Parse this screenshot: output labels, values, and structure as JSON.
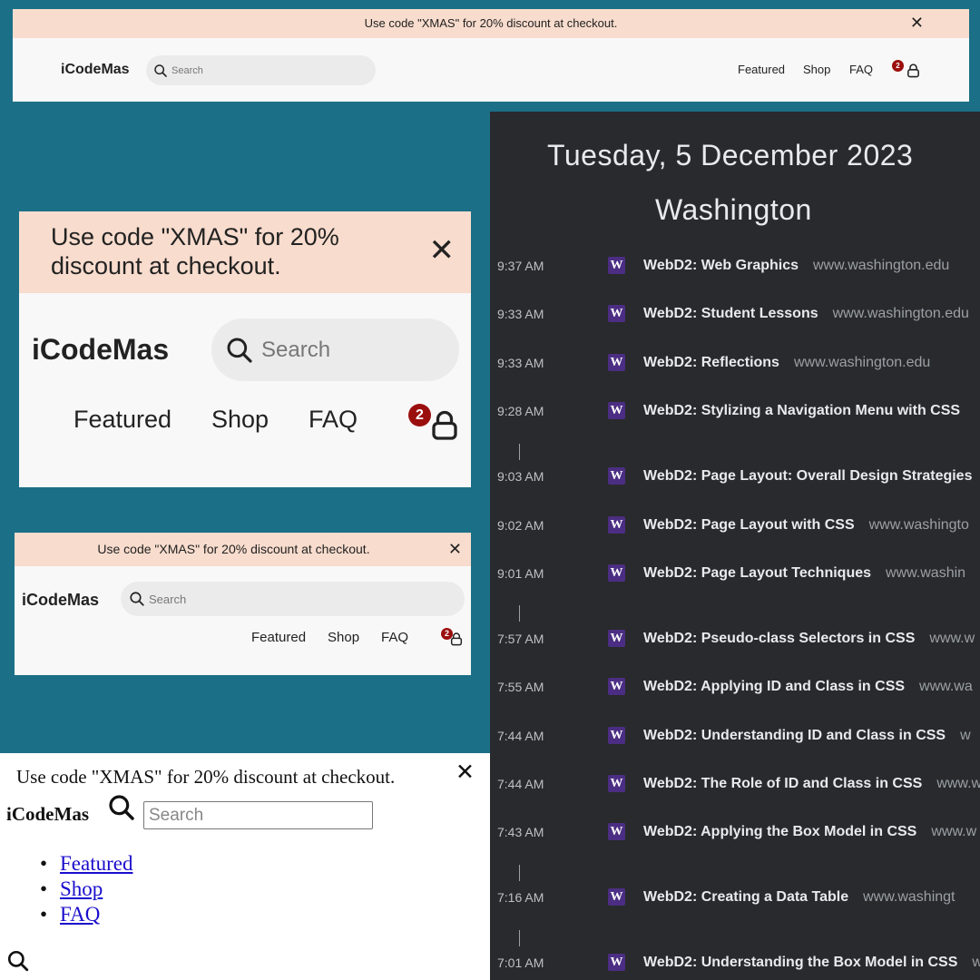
{
  "promo": {
    "text": "Use code \"XMAS\" for 20% discount at checkout.",
    "close_label": "✕"
  },
  "nav": {
    "brand": "iCodeMas",
    "search_placeholder": "Search",
    "links": [
      "Featured",
      "Shop",
      "FAQ"
    ],
    "cart_count": "2"
  },
  "history": {
    "date": "Tuesday, 5 December 2023",
    "location": "Washington",
    "favicon_letter": "W",
    "entries": [
      {
        "time": "9:37 AM",
        "title": "WebD2: Web Graphics",
        "domain": "www.washington.edu"
      },
      {
        "time": "9:33 AM",
        "title": "WebD2: Student Lessons",
        "domain": "www.washington.edu"
      },
      {
        "time": "9:33 AM",
        "title": "WebD2: Reflections",
        "domain": "www.washington.edu"
      },
      {
        "time": "9:28 AM",
        "title": "WebD2: Stylizing a Navigation Menu with CSS",
        "domain": ""
      },
      {
        "time": "9:03 AM",
        "title": "WebD2: Page Layout: Overall Design Strategies",
        "domain": ""
      },
      {
        "time": "9:02 AM",
        "title": "WebD2: Page Layout with CSS",
        "domain": "www.washingto"
      },
      {
        "time": "9:01 AM",
        "title": "WebD2: Page Layout Techniques",
        "domain": "www.washin"
      },
      {
        "time": "7:57 AM",
        "title": "WebD2: Pseudo-class Selectors in CSS",
        "domain": "www.w"
      },
      {
        "time": "7:55 AM",
        "title": "WebD2: Applying ID and Class in CSS",
        "domain": "www.wa"
      },
      {
        "time": "7:44 AM",
        "title": "WebD2: Understanding ID and Class in CSS",
        "domain": "w"
      },
      {
        "time": "7:44 AM",
        "title": "WebD2: The Role of ID and Class in CSS",
        "domain": "www.w"
      },
      {
        "time": "7:43 AM",
        "title": "WebD2: Applying the Box Model in CSS",
        "domain": "www.w"
      },
      {
        "time": "7:16 AM",
        "title": "WebD2: Creating a Data Table",
        "domain": "www.washingt"
      },
      {
        "time": "7:01 AM",
        "title": "WebD2: Understanding the Box Model in CSS",
        "domain": "w"
      }
    ]
  },
  "colors": {
    "teal_background": "#1b6f86",
    "banner_peach": "#f8dccd",
    "badge_red": "#9b0e0e",
    "history_dark": "#292a2d",
    "uw_purple": "#4b2e83"
  }
}
